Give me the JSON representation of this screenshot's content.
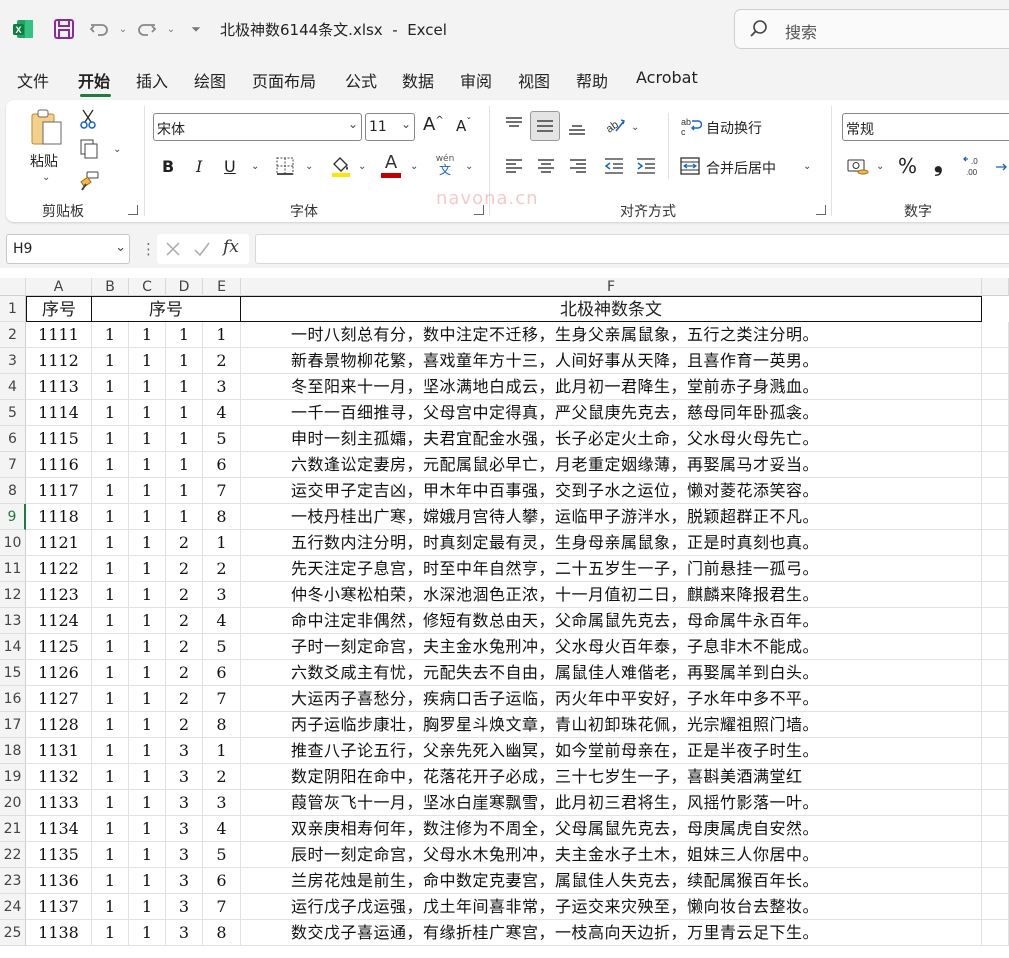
{
  "titlebar": {
    "filename": "北极神数6144条文.xlsx",
    "separator": "-",
    "app": "Excel",
    "search_placeholder": "搜索"
  },
  "menu": [
    "文件",
    "开始",
    "插入",
    "绘图",
    "页面布局",
    "公式",
    "数据",
    "审阅",
    "视图",
    "帮助",
    "Acrobat"
  ],
  "ribbon": {
    "paste_label": "粘贴",
    "clipboard_label": "剪贴板",
    "font_name": "宋体",
    "font_size": "11",
    "font_group_label": "字体",
    "bold": "B",
    "italic": "I",
    "underline": "U",
    "font_color_letter": "A",
    "phonetic_top": "wén",
    "phonetic_bottom": "文",
    "grow_font": "A",
    "shrink_font": "A",
    "wrap_text": "自动换行",
    "merge_center": "合并后居中",
    "align_group_label": "对齐方式",
    "number_format": "常规",
    "number_group_label": "数字",
    "percent": "%",
    "comma": "❟",
    "font_color": "#c00000",
    "fill_color": "#ffe600"
  },
  "formula_bar": {
    "name_box": "H9",
    "fx": "fx",
    "value": ""
  },
  "watermark": "navona.cn",
  "sheet": {
    "columns": [
      "A",
      "B",
      "C",
      "D",
      "E",
      "F"
    ],
    "header_row": {
      "a": "序号",
      "bcde": "序号",
      "f": "北极神数条文"
    },
    "selected_row": 9,
    "rows": [
      {
        "n": "2",
        "a": "1111",
        "b": "1",
        "c": "1",
        "d": "1",
        "e": "1",
        "f": "一时八刻总有分，数中注定不迁移，生身父亲属鼠象，五行之类注分明。"
      },
      {
        "n": "3",
        "a": "1112",
        "b": "1",
        "c": "1",
        "d": "1",
        "e": "2",
        "f": "新春景物柳花繁，喜戏童年方十三，人间好事从天降，且喜作育一英男。"
      },
      {
        "n": "4",
        "a": "1113",
        "b": "1",
        "c": "1",
        "d": "1",
        "e": "3",
        "f": "冬至阳来十一月，坚冰满地白成云，此月初一君降生，堂前赤子身溅血。"
      },
      {
        "n": "5",
        "a": "1114",
        "b": "1",
        "c": "1",
        "d": "1",
        "e": "4",
        "f": "一千一百细推寻，父母宫中定得真，严父鼠庚先克去，慈母同年卧孤衾。"
      },
      {
        "n": "6",
        "a": "1115",
        "b": "1",
        "c": "1",
        "d": "1",
        "e": "5",
        "f": "申时一刻主孤孀，夫君宜配金水强，长子必定火土命，父水母火母先亡。"
      },
      {
        "n": "7",
        "a": "1116",
        "b": "1",
        "c": "1",
        "d": "1",
        "e": "6",
        "f": "六数逢讼定妻房，元配属鼠必早亡，月老重定姻缘薄，再娶属马才妥当。"
      },
      {
        "n": "8",
        "a": "1117",
        "b": "1",
        "c": "1",
        "d": "1",
        "e": "7",
        "f": "运交甲子定吉凶，甲木年中百事强，交到子水之运位，懒对菱花添笑容。"
      },
      {
        "n": "9",
        "a": "1118",
        "b": "1",
        "c": "1",
        "d": "1",
        "e": "8",
        "f": "一枝丹桂出广寒，嫦娥月宫待人攀，运临甲子游泮水，脱颖超群正不凡。"
      },
      {
        "n": "10",
        "a": "1121",
        "b": "1",
        "c": "1",
        "d": "2",
        "e": "1",
        "f": "五行数内注分明，时真刻定最有灵，生身母亲属鼠象，正是时真刻也真。"
      },
      {
        "n": "11",
        "a": "1122",
        "b": "1",
        "c": "1",
        "d": "2",
        "e": "2",
        "f": "先天注定子息宫，时至中年自然亨，二十五岁生一子，门前悬挂一孤弓。"
      },
      {
        "n": "12",
        "a": "1123",
        "b": "1",
        "c": "1",
        "d": "2",
        "e": "3",
        "f": "仲冬小寒松柏荣，水深池涸色正浓，十一月值初二日，麒麟来降报君生。"
      },
      {
        "n": "13",
        "a": "1124",
        "b": "1",
        "c": "1",
        "d": "2",
        "e": "4",
        "f": "命中注定非偶然，修短有数总由天，父命属鼠先克去，母命属牛永百年。"
      },
      {
        "n": "14",
        "a": "1125",
        "b": "1",
        "c": "1",
        "d": "2",
        "e": "5",
        "f": "子时一刻定命宫，夫主金水兔刑冲，父水母火百年泰，子息非木不能成。"
      },
      {
        "n": "15",
        "a": "1126",
        "b": "1",
        "c": "1",
        "d": "2",
        "e": "6",
        "f": "六数爻咸主有忧，元配失去不自由，属鼠佳人难偕老，再娶属羊到白头。"
      },
      {
        "n": "16",
        "a": "1127",
        "b": "1",
        "c": "1",
        "d": "2",
        "e": "7",
        "f": "大运丙子喜愁分，疾病口舌子运临，丙火年中平安好，子水年中多不平。"
      },
      {
        "n": "17",
        "a": "1128",
        "b": "1",
        "c": "1",
        "d": "2",
        "e": "8",
        "f": "丙子运临步康壮，胸罗星斗焕文章，青山初卸珠花佩，光宗耀祖照门墙。"
      },
      {
        "n": "18",
        "a": "1131",
        "b": "1",
        "c": "1",
        "d": "3",
        "e": "1",
        "f": "推查八子论五行，父亲先死入幽冥，如今堂前母亲在，正是半夜子时生。"
      },
      {
        "n": "19",
        "a": "1132",
        "b": "1",
        "c": "1",
        "d": "3",
        "e": "2",
        "f": " 数定阴阳在命中，花落花开子必成，三十七岁生一子，喜斟美酒满堂红"
      },
      {
        "n": "20",
        "a": "1133",
        "b": "1",
        "c": "1",
        "d": "3",
        "e": "3",
        "f": "葭管灰飞十一月，坚冰白崖寒飘雪，此月初三君将生，风摇竹影落一叶。"
      },
      {
        "n": "21",
        "a": "1134",
        "b": "1",
        "c": "1",
        "d": "3",
        "e": "4",
        "f": "双亲庚相寿何年，数注修为不周全，父母属鼠先克去，母庚属虎自安然。"
      },
      {
        "n": "22",
        "a": "1135",
        "b": "1",
        "c": "1",
        "d": "3",
        "e": "5",
        "f": "辰时一刻定命宫，父母水木兔刑冲，夫主金水子土木，姐妹三人你居中。"
      },
      {
        "n": "23",
        "a": "1136",
        "b": "1",
        "c": "1",
        "d": "3",
        "e": "6",
        "f": "兰房花烛是前生，命中数定克妻宫，属鼠佳人失克去，续配属猴百年长。"
      },
      {
        "n": "24",
        "a": "1137",
        "b": "1",
        "c": "1",
        "d": "3",
        "e": "7",
        "f": "运行戊子戊运强，戊土年间喜非常，子运交来灾殃至，懒向妆台去整妆。"
      },
      {
        "n": "25",
        "a": "1138",
        "b": "1",
        "c": "1",
        "d": "3",
        "e": "8",
        "f": "数交戊子喜运通，有缘折桂广寒宫，一枝高向天边折，万里青云足下生。"
      }
    ]
  }
}
